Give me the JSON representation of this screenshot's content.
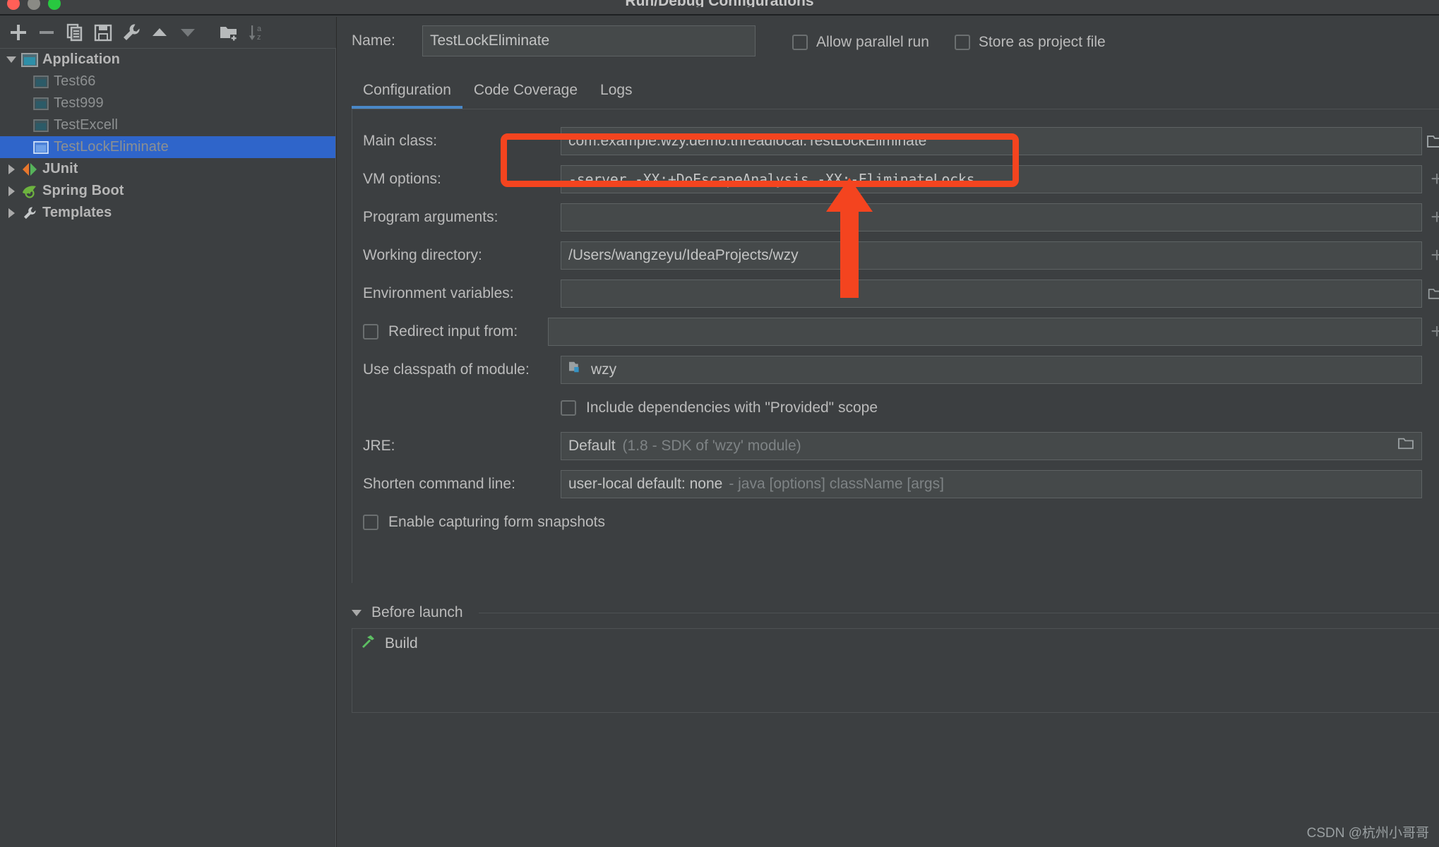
{
  "window": {
    "title": "Run/Debug Configurations"
  },
  "left_panel": {
    "toolbar": [
      {
        "name": "add-configuration-button",
        "icon": "plus-icon",
        "tooltip": "Add New Configuration"
      },
      {
        "name": "remove-configuration-button",
        "icon": "minus-icon",
        "tooltip": "Remove Configuration"
      },
      {
        "name": "copy-configuration-button",
        "icon": "copy-icon",
        "tooltip": "Copy Configuration"
      },
      {
        "name": "save-configuration-button",
        "icon": "save-icon",
        "tooltip": "Save Configuration"
      },
      {
        "name": "edit-templates-button",
        "icon": "wrench-icon",
        "tooltip": "Edit Templates"
      },
      {
        "name": "move-up-button",
        "icon": "arrow-up-icon",
        "tooltip": "Move Up"
      },
      {
        "name": "move-down-button",
        "icon": "arrow-down-icon",
        "tooltip": "Move Down"
      },
      {
        "name": "create-folder-button",
        "icon": "new-folder-icon",
        "tooltip": "Create New Folder"
      },
      {
        "name": "sort-configurations-button",
        "icon": "sort-alpha-icon",
        "tooltip": "Sort Configurations"
      }
    ],
    "tree": [
      {
        "label": "Application",
        "level": 0,
        "expanded": true,
        "icon": "application-icon",
        "selected": false
      },
      {
        "label": "Test66",
        "level": 1,
        "expanded": null,
        "icon": "application-icon",
        "selected": false
      },
      {
        "label": "Test999",
        "level": 1,
        "expanded": null,
        "icon": "application-icon",
        "selected": false
      },
      {
        "label": "TestExcell",
        "level": 1,
        "expanded": null,
        "icon": "application-icon",
        "selected": false
      },
      {
        "label": "TestLockEliminate",
        "level": 1,
        "expanded": null,
        "icon": "application-icon",
        "selected": true
      },
      {
        "label": "JUnit",
        "level": 0,
        "expanded": false,
        "icon": "junit-icon",
        "selected": false
      },
      {
        "label": "Spring Boot",
        "level": 0,
        "expanded": false,
        "icon": "spring-boot-icon",
        "selected": false
      },
      {
        "label": "Templates",
        "level": 0,
        "expanded": false,
        "icon": "wrench-icon",
        "selected": false
      }
    ]
  },
  "header": {
    "name_label": "Name:",
    "name_value": "TestLockEliminate",
    "allow_parallel_run_label": "Allow parallel run",
    "allow_parallel_run_checked": false,
    "store_as_project_file_label": "Store as project file",
    "store_as_project_file_checked": false
  },
  "tabs": [
    {
      "label": "Configuration",
      "active": true
    },
    {
      "label": "Code Coverage",
      "active": false
    },
    {
      "label": "Logs",
      "active": false
    }
  ],
  "form": {
    "main_class": {
      "label": "Main class:",
      "value": "com.example.wzy.demo.threadlocal.TestLockEliminate"
    },
    "vm_options": {
      "label": "VM options:",
      "value": "-server -XX:+DoEscapeAnalysis -XX:-EliminateLocks",
      "expand_icon": "plus-icon",
      "highlighted": true
    },
    "program_arguments": {
      "label": "Program arguments:",
      "value": "",
      "expand_icon": "plus-icon"
    },
    "working_directory": {
      "label": "Working directory:",
      "value": "/Users/wangzeyu/IdeaProjects/wzy",
      "expand_icon": "plus-icon"
    },
    "environment_variables": {
      "label": "Environment variables:",
      "value": "",
      "browse_icon": "folder-icon"
    },
    "redirect_input_from": {
      "label": "Redirect input from:",
      "checked": false,
      "value": "",
      "expand_icon": "plus-icon"
    },
    "use_classpath_of_module": {
      "label": "Use classpath of module:",
      "value": "wzy",
      "icon": "module-folder-icon"
    },
    "include_provided_dependencies": {
      "label": "Include dependencies with \"Provided\" scope",
      "checked": false
    },
    "jre": {
      "label": "JRE:",
      "value": "Default",
      "hint": "(1.8 - SDK of 'wzy' module)",
      "browse_icon": "folder-icon"
    },
    "shorten_command_line": {
      "label": "Shorten command line:",
      "value": "user-local default: none",
      "hint": "- java [options] className [args]"
    },
    "enable_capturing_form_snapshots": {
      "label": "Enable capturing form snapshots",
      "checked": false
    }
  },
  "before_launch": {
    "title": "Before launch",
    "expanded": true,
    "items": [
      {
        "label": "Build",
        "icon": "build-hammer-icon"
      }
    ]
  },
  "watermark": {
    "text": "CSDN @杭州小哥哥"
  },
  "colors": {
    "background": "#3c3f41",
    "selection": "#2f65ca",
    "accent_tab": "#4a88c7",
    "annotation": "#f4441f",
    "field_bg": "#45494a",
    "text": "#bbbbbb"
  }
}
